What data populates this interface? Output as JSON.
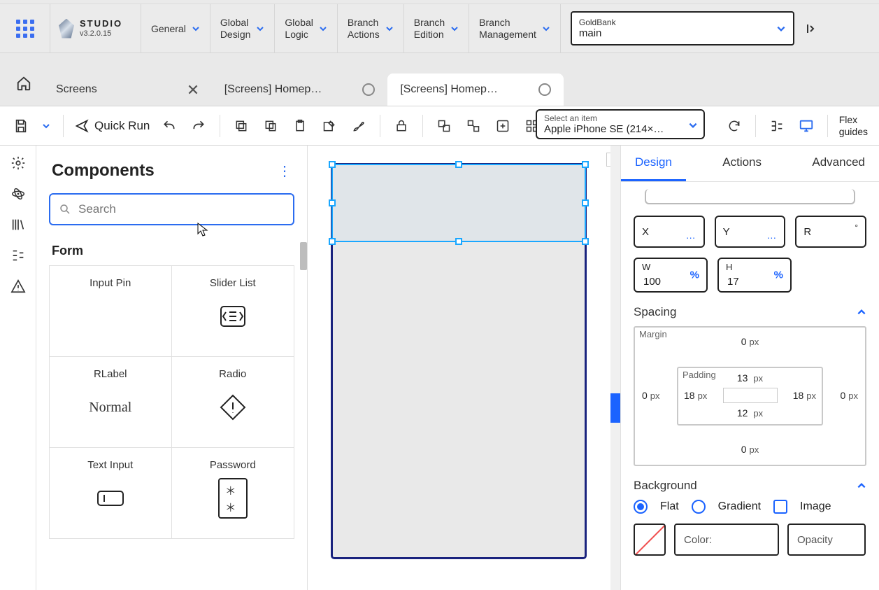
{
  "brand": {
    "title": "STUDIO",
    "version": "v3.2.0.15"
  },
  "menu": {
    "general": "General",
    "globalDesign": "Global\nDesign",
    "globalLogic": "Global\nLogic",
    "branchActions": "Branch\nActions",
    "branchEdition": "Branch\nEdition",
    "branchManagement": "Branch\nManagement"
  },
  "branch": {
    "label": "GoldBank",
    "value": "main"
  },
  "tabs": [
    {
      "title": "Screens"
    },
    {
      "title": "[Screens] Homep…"
    },
    {
      "title": "[Screens] Homep…"
    }
  ],
  "toolbar": {
    "quickRun": "Quick Run",
    "devicePicker": {
      "label": "Select an item",
      "value": "Apple iPhone SE (214×…"
    },
    "flexGuides": "Flex\nguides"
  },
  "leftPanel": {
    "title": "Components",
    "searchPlaceholder": "Search",
    "section": "Form",
    "items": [
      {
        "label": "Input Pin"
      },
      {
        "label": "Slider List"
      },
      {
        "label": "RLabel",
        "sub": "Normal"
      },
      {
        "label": "Radio"
      },
      {
        "label": "Text Input"
      },
      {
        "label": "Password",
        "sub": "＊＊"
      }
    ]
  },
  "rightPanel": {
    "tabs": {
      "design": "Design",
      "actions": "Actions",
      "advanced": "Advanced"
    },
    "pos": {
      "x": "X",
      "y": "Y",
      "r": "R",
      "w": "W",
      "wval": "100",
      "wunit": "%",
      "h": "H",
      "hval": "17",
      "hunit": "%",
      "dots": "…",
      "deg": "°"
    },
    "spacing": {
      "title": "Spacing",
      "marginLabel": "Margin",
      "paddingLabel": "Padding",
      "margin": {
        "top": "0",
        "right": "0",
        "bottom": "0",
        "left": "0"
      },
      "padding": {
        "top": "13",
        "right": "18",
        "bottom": "12",
        "left": "18"
      },
      "unit": "px"
    },
    "background": {
      "title": "Background",
      "flat": "Flat",
      "gradient": "Gradient",
      "image": "Image",
      "colorLabel": "Color:",
      "opacityLabel": "Opacity"
    }
  }
}
